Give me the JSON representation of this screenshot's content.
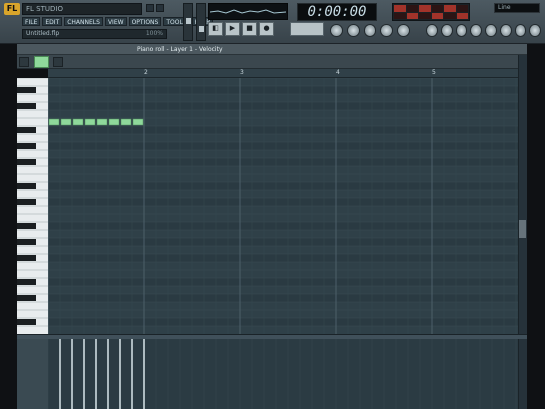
{
  "app": {
    "logo": "FL",
    "title": "FL STUDIO",
    "menu": [
      "FILE",
      "EDIT",
      "CHANNELS",
      "VIEW",
      "OPTIONS",
      "TOOLS",
      "HELP"
    ],
    "hint_text": "Untitled.flp",
    "hint_value": "100%"
  },
  "transport": {
    "time": "0:00:00",
    "buttons": [
      "◧",
      "▶",
      "■",
      "●"
    ],
    "pattern_field": ""
  },
  "right_field": "Line",
  "piano_roll": {
    "title": "Piano roll - Layer 1 - Velocity",
    "bar_numbers": [
      "2",
      "3",
      "4",
      "5"
    ]
  },
  "notes": {
    "count": 8,
    "row": 5
  },
  "colors": {
    "accent_green": "#8fd99b",
    "grid_bg": "#2f4048",
    "mixer_red": "#a2332a"
  },
  "icons": {
    "play": "play-icon",
    "stop": "stop-icon",
    "record": "record-icon"
  }
}
